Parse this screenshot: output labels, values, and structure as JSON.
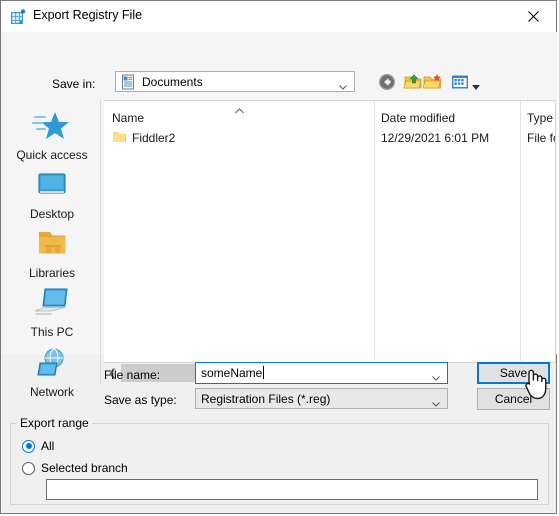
{
  "window": {
    "title": "Export Registry File",
    "icon": "registry-grid-icon",
    "close_label": "✕"
  },
  "savein": {
    "label": "Save in:",
    "value": "Documents",
    "icon": "documents-folder-icon",
    "dropdown_icon": "chevron-down-icon"
  },
  "toolbar": {
    "back": "back-arrow-icon",
    "up": "up-one-level-icon",
    "new_folder": "new-folder-icon",
    "views": "views-icon",
    "views_arrow": "chevron-down-icon"
  },
  "places": {
    "items": [
      {
        "label": "Quick access",
        "icon": "quick-access-star-icon"
      },
      {
        "label": "Desktop",
        "icon": "desktop-monitor-icon"
      },
      {
        "label": "Libraries",
        "icon": "libraries-folder-icon"
      },
      {
        "label": "This PC",
        "icon": "this-pc-computer-icon"
      },
      {
        "label": "Network",
        "icon": "network-globe-icon"
      }
    ]
  },
  "filelist": {
    "columns": [
      "Name",
      "Date modified",
      "Type"
    ],
    "sort_indicator": "sort-ascending-icon",
    "rows": [
      {
        "name": "Fiddler2",
        "date_modified": "12/29/2021 6:01 PM",
        "type": "File fo",
        "icon": "folder-icon"
      }
    ]
  },
  "scrollbar": {
    "left_arrow": "❮",
    "right_arrow": "❯"
  },
  "form": {
    "filename_label": "File name:",
    "filename_value": "someName",
    "filename_placeholder": "",
    "savetype_label": "Save as type:",
    "savetype_value": "Registration Files (*.reg)",
    "savetype_options": [
      "Registration Files (*.reg)"
    ],
    "save_button": "Save",
    "cancel_button": "Cancel",
    "cursor": "hand-pointer-cursor"
  },
  "export_range": {
    "title": "Export range",
    "options": [
      {
        "label": "All",
        "selected": true
      },
      {
        "label": "Selected branch",
        "selected": false
      }
    ],
    "branch_value": "",
    "branch_placeholder": ""
  },
  "colors": {
    "accent": "#0078d7",
    "dialog_bg": "#f0f0f0",
    "panel_bg": "#f5f5f5",
    "folder_yellow": "#ffd966"
  }
}
